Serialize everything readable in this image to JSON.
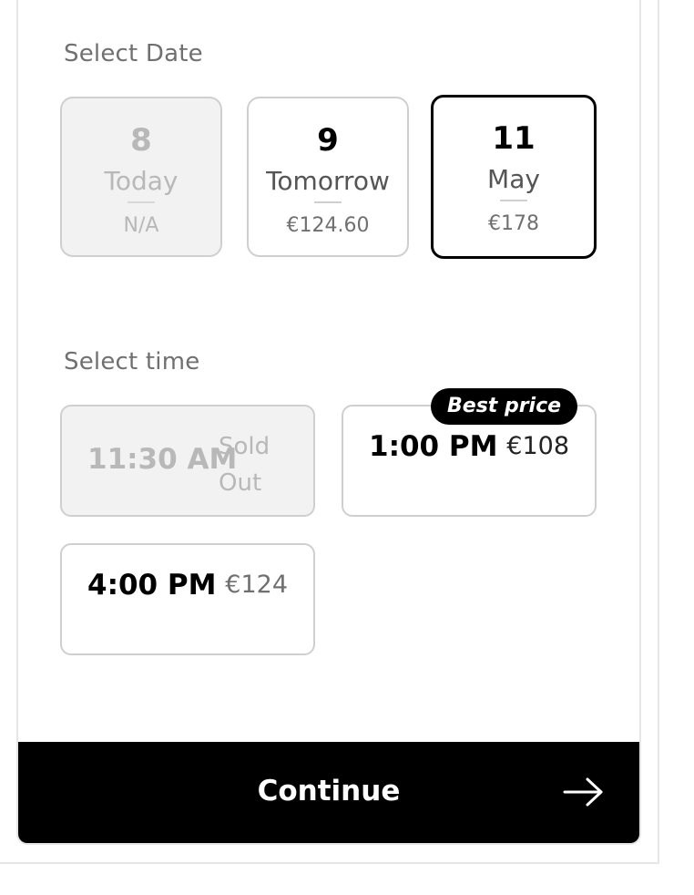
{
  "date_section": {
    "label": "Select Date",
    "dates": [
      {
        "day": "8",
        "month": "Today",
        "price": "N/A",
        "state": "disabled"
      },
      {
        "day": "9",
        "month": "Tomorrow",
        "price": "€124.60",
        "state": "available"
      },
      {
        "day": "11",
        "month": "May",
        "price": "€178",
        "state": "selected"
      }
    ]
  },
  "time_section": {
    "label": "Select time",
    "slots": [
      {
        "time": "11:30 AM",
        "status_line1": "Sold",
        "status_line2": "Out",
        "state": "disabled"
      },
      {
        "time": "1:00 PM",
        "price": "€108",
        "badge": "Best price",
        "state": "available"
      },
      {
        "time": "4:00 PM",
        "price": "€124",
        "state": "available"
      }
    ]
  },
  "footer": {
    "continue_label": "Continue",
    "arrow_icon": "arrow-right-icon"
  },
  "colors": {
    "primary": "#000000",
    "border": "#cfcfcf",
    "disabled_bg": "#f2f2f2",
    "muted_text": "#707070"
  }
}
